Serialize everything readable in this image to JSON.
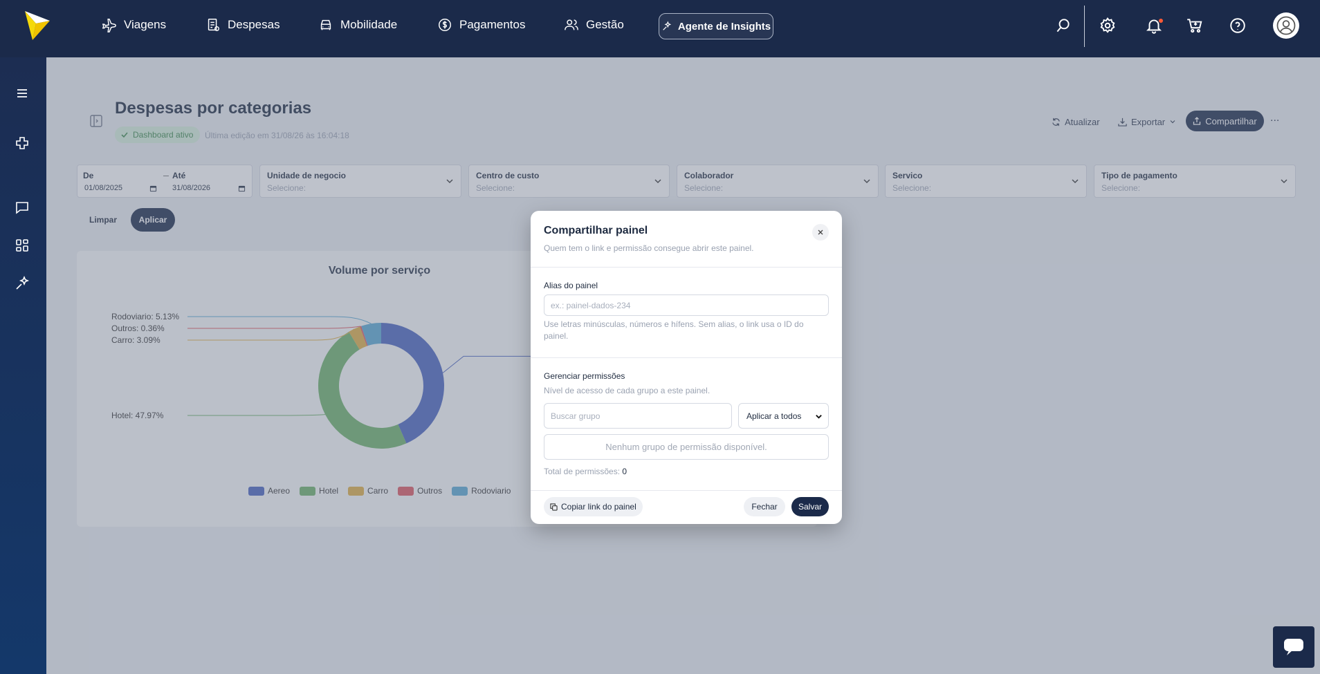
{
  "topnav": {
    "items": [
      {
        "label": "Viagens",
        "icon": "plane-icon"
      },
      {
        "label": "Despesas",
        "icon": "receipt-icon"
      },
      {
        "label": "Mobilidade",
        "icon": "car-icon"
      },
      {
        "label": "Pagamentos",
        "icon": "dollar-icon"
      },
      {
        "label": "Gestão",
        "icon": "users-icon"
      }
    ],
    "insights_label": "Agente de Insights"
  },
  "page": {
    "title": "Despesas por categorias",
    "status": "Dashboard ativo",
    "last_edit": "Última edição em 31/08/26 às 16:04:18",
    "actions": {
      "refresh": "Atualizar",
      "export": "Exportar",
      "share": "Compartilhar",
      "more": "..."
    }
  },
  "filters": {
    "from_label": "De",
    "from_value": "01/08/2025",
    "to_label": "Até",
    "to_value": "31/08/2026",
    "dropdowns": [
      {
        "label": "Unidade de negocio",
        "placeholder": "Selecione:"
      },
      {
        "label": "Centro de custo",
        "placeholder": "Selecione:"
      },
      {
        "label": "Colaborador",
        "placeholder": "Selecione:"
      },
      {
        "label": "Servico",
        "placeholder": "Selecione:"
      },
      {
        "label": "Tipo de pagamento",
        "placeholder": "Selecione:"
      }
    ],
    "clear_label": "Limpar",
    "apply_label": "Aplicar"
  },
  "chart_data": {
    "type": "pie",
    "title": "Volume por serviço",
    "categories": [
      "Aereo",
      "Hotel",
      "Carro",
      "Outros",
      "Rodoviario"
    ],
    "values": [
      43.45,
      47.97,
      3.09,
      0.36,
      5.13
    ],
    "colors": [
      "#4a64c0",
      "#6db36a",
      "#e0b044",
      "#de5861",
      "#5aa9d4"
    ],
    "data_labels": [
      "Rodoviario: 5.13%",
      "Outros: 0.36%",
      "Carro: 3.09%",
      "Hotel: 47.97%"
    ],
    "legend_position": "bottom"
  },
  "modal": {
    "title": "Compartilhar painel",
    "subtitle": "Quem tem o link e permissão consegue abrir este painel.",
    "alias_label": "Alias do painel",
    "alias_placeholder": "ex.: painel-dados-234",
    "alias_hint": "Use letras minúsculas, números e hífens. Sem alias, o link usa o ID do painel.",
    "perm_label": "Gerenciar permissões",
    "perm_hint": "Nível de acesso de cada grupo a este painel.",
    "group_placeholder": "Buscar grupo",
    "apply_all": "Aplicar a todos",
    "empty": "Nenhum grupo de permissão disponível.",
    "total_label": "Total de permissões:",
    "total_value": "0",
    "copy_link": "Copiar link do painel",
    "close": "Fechar",
    "save": "Salvar"
  }
}
